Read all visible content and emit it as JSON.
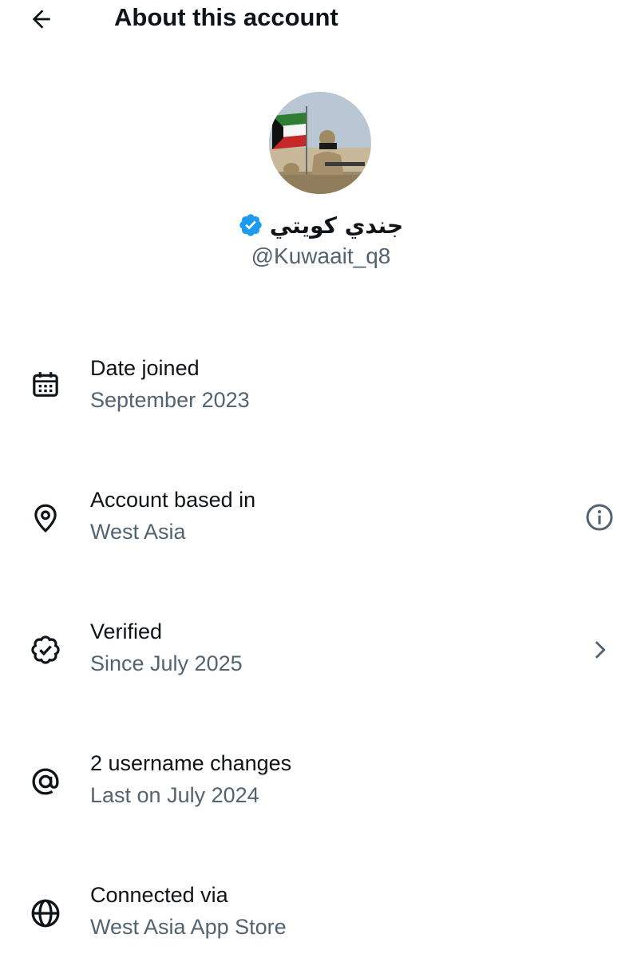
{
  "header": {
    "title": "About this account",
    "back_icon": "arrow-left-icon"
  },
  "profile": {
    "display_name": "جندي كويتي",
    "handle": "@Kuwaait_q8",
    "verified": true,
    "verified_color": "#1d9bf0"
  },
  "rows": [
    {
      "icon": "calendar-icon",
      "label": "Date joined",
      "value": "September 2023"
    },
    {
      "icon": "location-pin-icon",
      "label": "Account based in",
      "value": "West Asia",
      "action_icon": "info-icon"
    },
    {
      "icon": "verified-badge-outline-icon",
      "label": "Verified",
      "value": "Since July 2025",
      "action_icon": "chevron-right-icon"
    },
    {
      "icon": "at-sign-icon",
      "label": "2 username changes",
      "value": "Last on July 2024"
    },
    {
      "icon": "globe-icon",
      "label": "Connected via",
      "value": "West Asia App Store"
    }
  ],
  "colors": {
    "text_primary": "#0f1419",
    "text_secondary": "#536471",
    "accent": "#1d9bf0",
    "background": "#ffffff"
  }
}
